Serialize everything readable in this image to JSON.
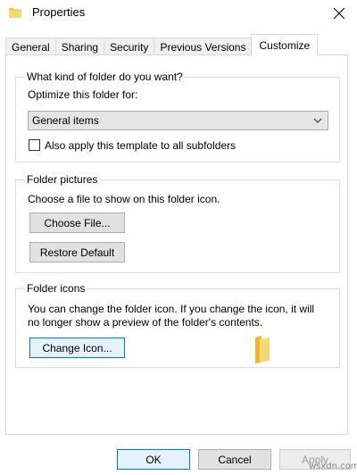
{
  "window": {
    "title": "Properties",
    "icon": "folder-icon"
  },
  "tabs": [
    {
      "label": "General"
    },
    {
      "label": "Sharing"
    },
    {
      "label": "Security"
    },
    {
      "label": "Previous Versions"
    },
    {
      "label": "Customize",
      "active": true
    }
  ],
  "kind": {
    "group_title": "What kind of folder do you want?",
    "optimize_label": "Optimize this folder for:",
    "dropdown_value": "General items",
    "subfolders_checkbox_label": "Also apply this template to all subfolders",
    "subfolders_checked": false
  },
  "pictures": {
    "group_title": "Folder pictures",
    "description": "Choose a file to show on this folder icon.",
    "choose_file_button": "Choose File...",
    "restore_default_button": "Restore Default"
  },
  "icons": {
    "group_title": "Folder icons",
    "description_line1": "You can change the folder icon. If you change the icon, it will",
    "description_line2": "no longer show a preview of the folder's contents.",
    "change_icon_button": "Change Icon..."
  },
  "footer": {
    "ok_button": "OK",
    "cancel_button": "Cancel",
    "apply_button": "Apply"
  },
  "watermark": "wsxdn.com",
  "colors": {
    "folder": "#f5c949",
    "focus_border": "#0078d7"
  }
}
